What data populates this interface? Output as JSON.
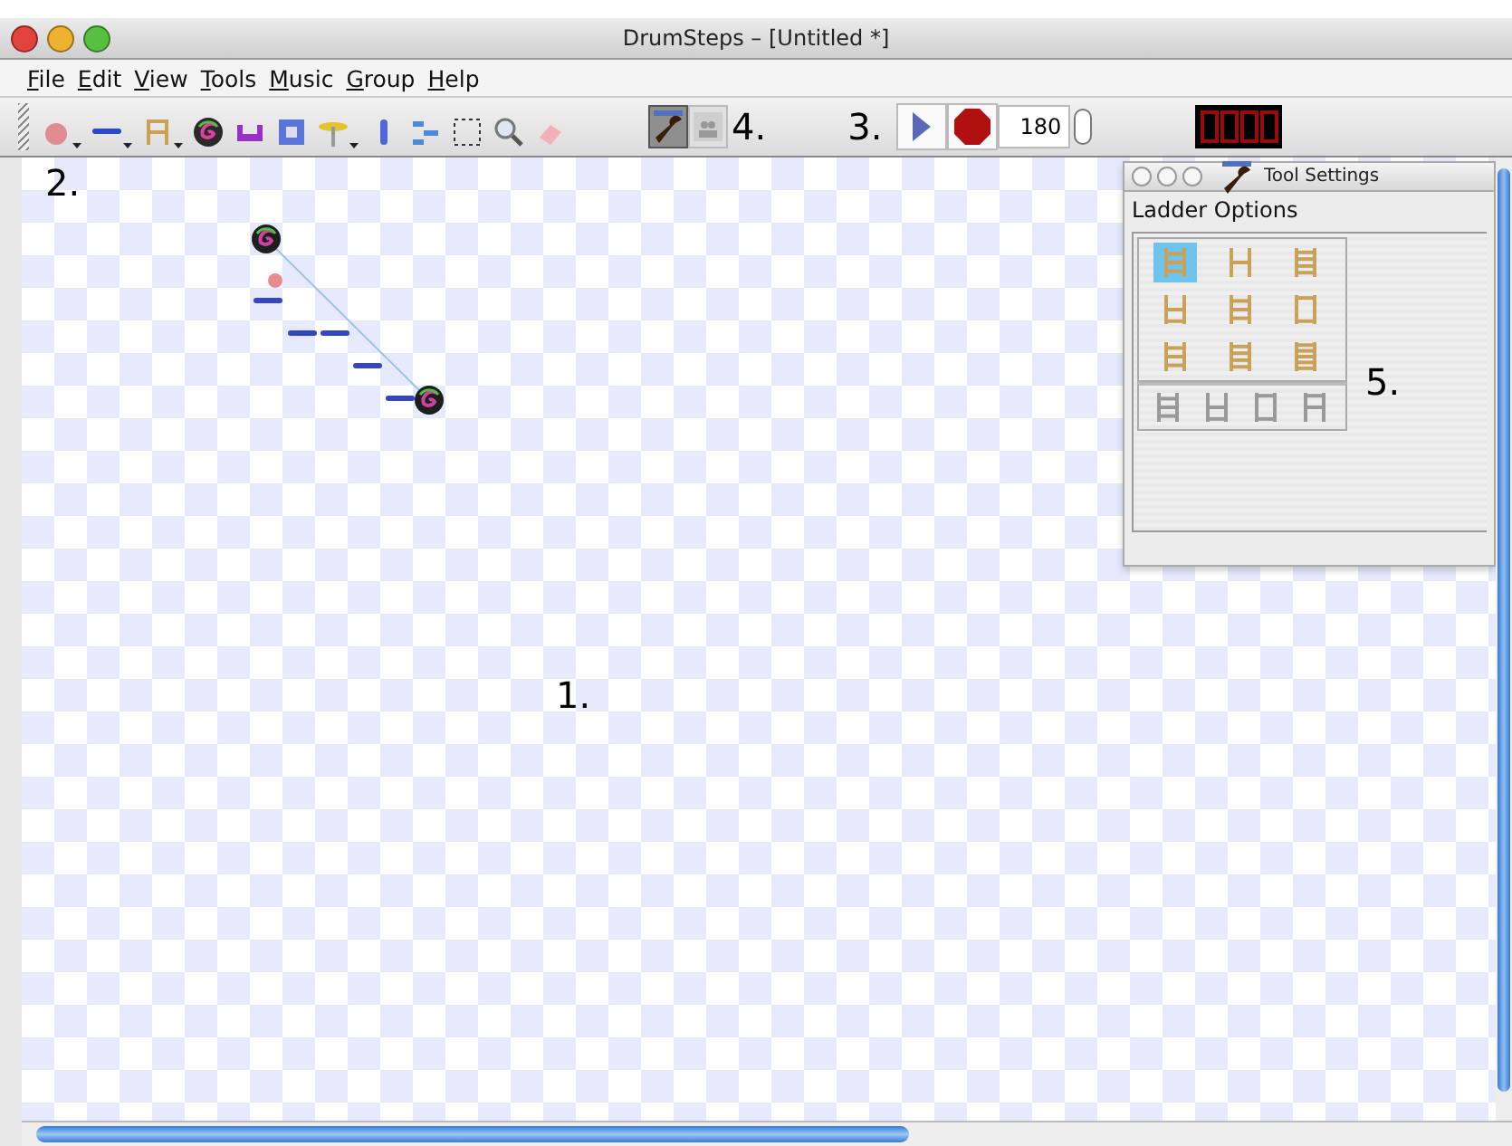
{
  "window": {
    "title": "DrumSteps – [Untitled *]"
  },
  "menu": [
    {
      "label": "File"
    },
    {
      "label": "Edit"
    },
    {
      "label": "View"
    },
    {
      "label": "Tools"
    },
    {
      "label": "Music"
    },
    {
      "label": "Group"
    },
    {
      "label": "Help"
    }
  ],
  "toolbar": {
    "tools": [
      {
        "kind": "ball",
        "dropdown": true
      },
      {
        "kind": "bar",
        "dropdown": true
      },
      {
        "kind": "ladder",
        "dropdown": true
      },
      {
        "kind": "spiral",
        "dropdown": false
      },
      {
        "kind": "trough",
        "dropdown": false
      },
      {
        "kind": "box",
        "dropdown": false
      },
      {
        "kind": "cymbal",
        "dropdown": true
      },
      {
        "kind": "post",
        "dropdown": false
      },
      {
        "kind": "steps",
        "dropdown": false
      },
      {
        "kind": "select",
        "dropdown": false
      },
      {
        "kind": "zoom",
        "dropdown": false
      },
      {
        "kind": "eraser",
        "dropdown": false
      }
    ],
    "toggles": [
      {
        "kind": "settings",
        "selected": true
      },
      {
        "kind": "group",
        "selected": false
      }
    ],
    "tempo": "180"
  },
  "annotations": [
    "2.",
    "4.",
    "3.",
    "1.",
    "5."
  ],
  "tool_settings": {
    "title": "Tool Settings",
    "heading": "Ladder Options",
    "ladders": [
      {
        "kind": "three-rung",
        "selected": true
      },
      {
        "kind": "two-rung",
        "selected": false
      },
      {
        "kind": "four-rung",
        "selected": false
      },
      {
        "kind": "open-top",
        "selected": false
      },
      {
        "kind": "three-rung",
        "selected": false
      },
      {
        "kind": "box",
        "selected": false
      },
      {
        "kind": "three-rung",
        "selected": false
      },
      {
        "kind": "four-rung",
        "selected": false
      },
      {
        "kind": "five-rung",
        "selected": false
      }
    ],
    "disabled_ladders": [
      {
        "kind": "three-rung"
      },
      {
        "kind": "open-top"
      },
      {
        "kind": "box"
      },
      {
        "kind": "open-bottom"
      }
    ]
  }
}
